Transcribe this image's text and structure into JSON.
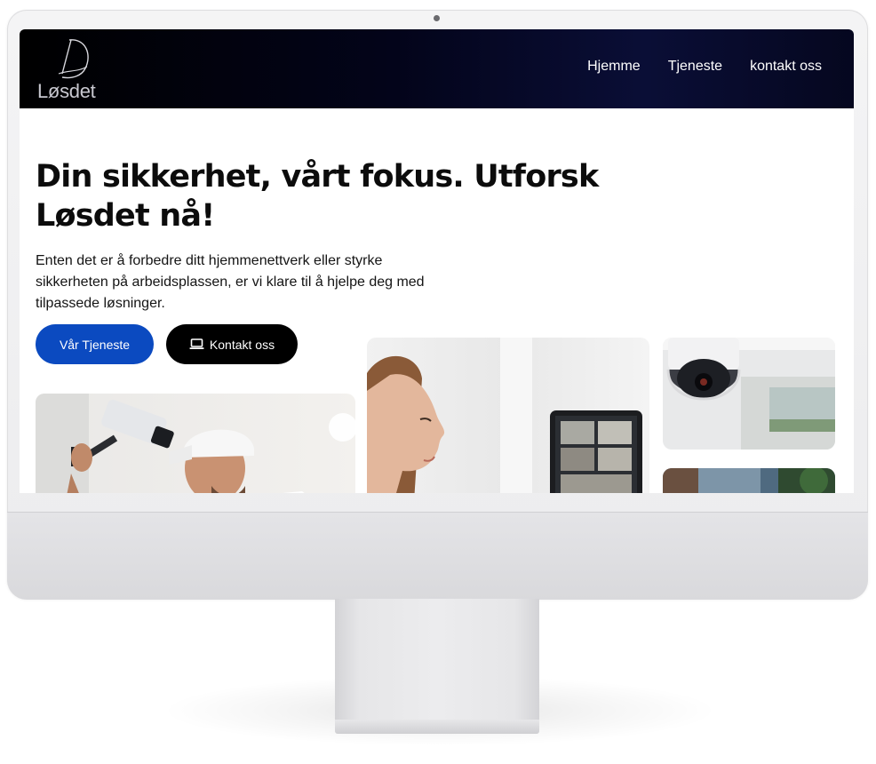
{
  "brand": {
    "name": "Løsdet",
    "logo_icon": "signature-d-logo"
  },
  "nav": {
    "items": [
      {
        "label": "Hjemme"
      },
      {
        "label": "Tjeneste"
      },
      {
        "label": "kontakt oss"
      }
    ]
  },
  "hero": {
    "title": "Din sikkerhet, vårt fokus. Utforsk Løsdet nå!",
    "text": "Enten det er å forbedre ditt hjemmenettverk eller styrke sikkerheten på arbeidsplassen, er vi klare til å hjelpe deg med tilpassede løsninger.",
    "primary_button": "Vår Tjeneste",
    "secondary_button": "Kontakt oss",
    "secondary_button_icon": "laptop-icon"
  },
  "photos": [
    {
      "subject": "installer-mounting-camera"
    },
    {
      "subject": "woman-with-tablet-camera-feed"
    },
    {
      "subject": "dome-security-camera"
    },
    {
      "subject": "office-interior"
    }
  ],
  "colors": {
    "nav_bg": "#03041a",
    "primary": "#0b4ac0",
    "dark_button": "#000000",
    "text": "#0c0c0c"
  }
}
